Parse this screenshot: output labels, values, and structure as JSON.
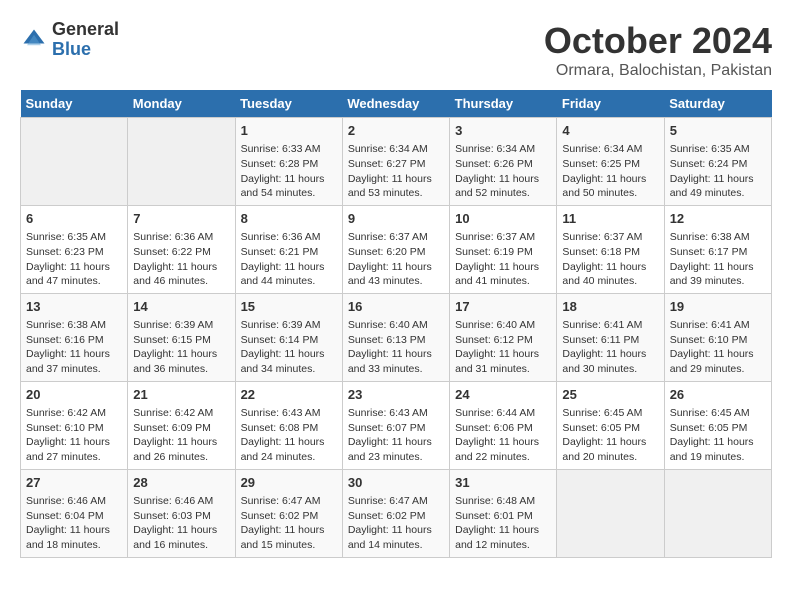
{
  "logo": {
    "general": "General",
    "blue": "Blue"
  },
  "title": "October 2024",
  "subtitle": "Ormara, Balochistan, Pakistan",
  "days_of_week": [
    "Sunday",
    "Monday",
    "Tuesday",
    "Wednesday",
    "Thursday",
    "Friday",
    "Saturday"
  ],
  "weeks": [
    [
      {
        "day": "",
        "sunrise": "",
        "sunset": "",
        "daylight": ""
      },
      {
        "day": "",
        "sunrise": "",
        "sunset": "",
        "daylight": ""
      },
      {
        "day": "1",
        "sunrise": "Sunrise: 6:33 AM",
        "sunset": "Sunset: 6:28 PM",
        "daylight": "Daylight: 11 hours and 54 minutes."
      },
      {
        "day": "2",
        "sunrise": "Sunrise: 6:34 AM",
        "sunset": "Sunset: 6:27 PM",
        "daylight": "Daylight: 11 hours and 53 minutes."
      },
      {
        "day": "3",
        "sunrise": "Sunrise: 6:34 AM",
        "sunset": "Sunset: 6:26 PM",
        "daylight": "Daylight: 11 hours and 52 minutes."
      },
      {
        "day": "4",
        "sunrise": "Sunrise: 6:34 AM",
        "sunset": "Sunset: 6:25 PM",
        "daylight": "Daylight: 11 hours and 50 minutes."
      },
      {
        "day": "5",
        "sunrise": "Sunrise: 6:35 AM",
        "sunset": "Sunset: 6:24 PM",
        "daylight": "Daylight: 11 hours and 49 minutes."
      }
    ],
    [
      {
        "day": "6",
        "sunrise": "Sunrise: 6:35 AM",
        "sunset": "Sunset: 6:23 PM",
        "daylight": "Daylight: 11 hours and 47 minutes."
      },
      {
        "day": "7",
        "sunrise": "Sunrise: 6:36 AM",
        "sunset": "Sunset: 6:22 PM",
        "daylight": "Daylight: 11 hours and 46 minutes."
      },
      {
        "day": "8",
        "sunrise": "Sunrise: 6:36 AM",
        "sunset": "Sunset: 6:21 PM",
        "daylight": "Daylight: 11 hours and 44 minutes."
      },
      {
        "day": "9",
        "sunrise": "Sunrise: 6:37 AM",
        "sunset": "Sunset: 6:20 PM",
        "daylight": "Daylight: 11 hours and 43 minutes."
      },
      {
        "day": "10",
        "sunrise": "Sunrise: 6:37 AM",
        "sunset": "Sunset: 6:19 PM",
        "daylight": "Daylight: 11 hours and 41 minutes."
      },
      {
        "day": "11",
        "sunrise": "Sunrise: 6:37 AM",
        "sunset": "Sunset: 6:18 PM",
        "daylight": "Daylight: 11 hours and 40 minutes."
      },
      {
        "day": "12",
        "sunrise": "Sunrise: 6:38 AM",
        "sunset": "Sunset: 6:17 PM",
        "daylight": "Daylight: 11 hours and 39 minutes."
      }
    ],
    [
      {
        "day": "13",
        "sunrise": "Sunrise: 6:38 AM",
        "sunset": "Sunset: 6:16 PM",
        "daylight": "Daylight: 11 hours and 37 minutes."
      },
      {
        "day": "14",
        "sunrise": "Sunrise: 6:39 AM",
        "sunset": "Sunset: 6:15 PM",
        "daylight": "Daylight: 11 hours and 36 minutes."
      },
      {
        "day": "15",
        "sunrise": "Sunrise: 6:39 AM",
        "sunset": "Sunset: 6:14 PM",
        "daylight": "Daylight: 11 hours and 34 minutes."
      },
      {
        "day": "16",
        "sunrise": "Sunrise: 6:40 AM",
        "sunset": "Sunset: 6:13 PM",
        "daylight": "Daylight: 11 hours and 33 minutes."
      },
      {
        "day": "17",
        "sunrise": "Sunrise: 6:40 AM",
        "sunset": "Sunset: 6:12 PM",
        "daylight": "Daylight: 11 hours and 31 minutes."
      },
      {
        "day": "18",
        "sunrise": "Sunrise: 6:41 AM",
        "sunset": "Sunset: 6:11 PM",
        "daylight": "Daylight: 11 hours and 30 minutes."
      },
      {
        "day": "19",
        "sunrise": "Sunrise: 6:41 AM",
        "sunset": "Sunset: 6:10 PM",
        "daylight": "Daylight: 11 hours and 29 minutes."
      }
    ],
    [
      {
        "day": "20",
        "sunrise": "Sunrise: 6:42 AM",
        "sunset": "Sunset: 6:10 PM",
        "daylight": "Daylight: 11 hours and 27 minutes."
      },
      {
        "day": "21",
        "sunrise": "Sunrise: 6:42 AM",
        "sunset": "Sunset: 6:09 PM",
        "daylight": "Daylight: 11 hours and 26 minutes."
      },
      {
        "day": "22",
        "sunrise": "Sunrise: 6:43 AM",
        "sunset": "Sunset: 6:08 PM",
        "daylight": "Daylight: 11 hours and 24 minutes."
      },
      {
        "day": "23",
        "sunrise": "Sunrise: 6:43 AM",
        "sunset": "Sunset: 6:07 PM",
        "daylight": "Daylight: 11 hours and 23 minutes."
      },
      {
        "day": "24",
        "sunrise": "Sunrise: 6:44 AM",
        "sunset": "Sunset: 6:06 PM",
        "daylight": "Daylight: 11 hours and 22 minutes."
      },
      {
        "day": "25",
        "sunrise": "Sunrise: 6:45 AM",
        "sunset": "Sunset: 6:05 PM",
        "daylight": "Daylight: 11 hours and 20 minutes."
      },
      {
        "day": "26",
        "sunrise": "Sunrise: 6:45 AM",
        "sunset": "Sunset: 6:05 PM",
        "daylight": "Daylight: 11 hours and 19 minutes."
      }
    ],
    [
      {
        "day": "27",
        "sunrise": "Sunrise: 6:46 AM",
        "sunset": "Sunset: 6:04 PM",
        "daylight": "Daylight: 11 hours and 18 minutes."
      },
      {
        "day": "28",
        "sunrise": "Sunrise: 6:46 AM",
        "sunset": "Sunset: 6:03 PM",
        "daylight": "Daylight: 11 hours and 16 minutes."
      },
      {
        "day": "29",
        "sunrise": "Sunrise: 6:47 AM",
        "sunset": "Sunset: 6:02 PM",
        "daylight": "Daylight: 11 hours and 15 minutes."
      },
      {
        "day": "30",
        "sunrise": "Sunrise: 6:47 AM",
        "sunset": "Sunset: 6:02 PM",
        "daylight": "Daylight: 11 hours and 14 minutes."
      },
      {
        "day": "31",
        "sunrise": "Sunrise: 6:48 AM",
        "sunset": "Sunset: 6:01 PM",
        "daylight": "Daylight: 11 hours and 12 minutes."
      },
      {
        "day": "",
        "sunrise": "",
        "sunset": "",
        "daylight": ""
      },
      {
        "day": "",
        "sunrise": "",
        "sunset": "",
        "daylight": ""
      }
    ]
  ]
}
